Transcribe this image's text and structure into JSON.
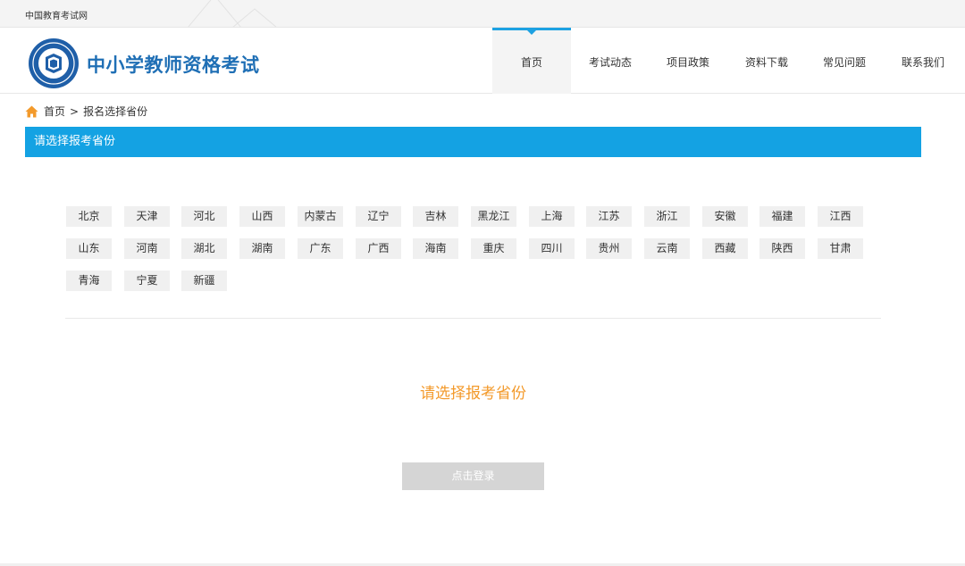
{
  "topbar": {
    "site_name": "中国教育考试网"
  },
  "header": {
    "brand": "中小学教师资格考试"
  },
  "nav": {
    "items": [
      {
        "label": "首页",
        "active": true
      },
      {
        "label": "考试动态",
        "active": false
      },
      {
        "label": "项目政策",
        "active": false
      },
      {
        "label": "资料下载",
        "active": false
      },
      {
        "label": "常见问题",
        "active": false
      },
      {
        "label": "联系我们",
        "active": false
      }
    ]
  },
  "breadcrumb": {
    "home": "首页",
    "separator": ">",
    "current": "报名选择省份"
  },
  "section": {
    "title": "请选择报考省份"
  },
  "provinces": [
    [
      "北京",
      "天津",
      "河北",
      "山西",
      "内蒙古",
      "辽宁",
      "吉林",
      "黑龙江",
      "上海",
      "江苏",
      "浙江",
      "安徽",
      "福建",
      "江西"
    ],
    [
      "山东",
      "河南",
      "湖北",
      "湖南",
      "广东",
      "广西",
      "海南",
      "重庆",
      "四川",
      "贵州",
      "云南",
      "西藏",
      "陕西",
      "甘肃"
    ],
    [
      "青海",
      "宁夏",
      "新疆"
    ]
  ],
  "prompt": "请选择报考省份",
  "login_button": "点击登录",
  "colors": {
    "accent": "#14a2e3",
    "brand": "#1f6fb5",
    "prompt": "#f39a2b",
    "disabled_button": "#d5d5d5"
  },
  "icons": {
    "home": "home-icon",
    "logo": "exam-logo-icon",
    "nav_active": "caret-down-icon"
  }
}
